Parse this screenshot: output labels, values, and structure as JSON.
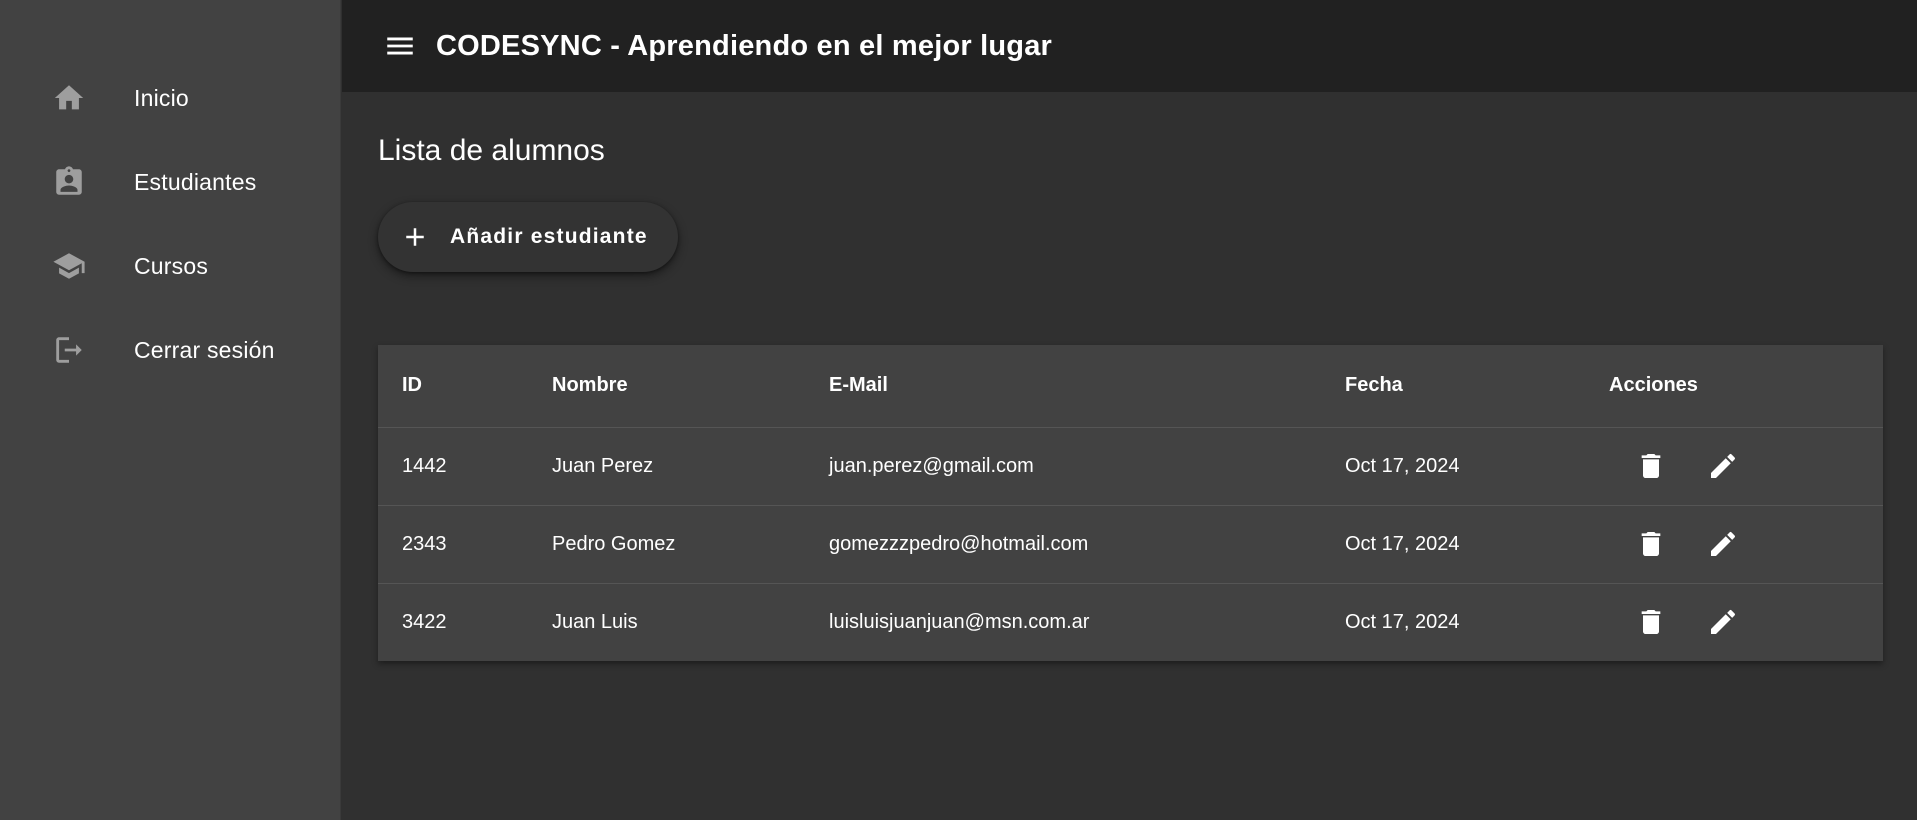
{
  "sidebar": {
    "items": [
      {
        "label": "Inicio",
        "icon": "home-icon"
      },
      {
        "label": "Estudiantes",
        "icon": "assignment-ind-icon"
      },
      {
        "label": "Cursos",
        "icon": "school-icon"
      },
      {
        "label": "Cerrar sesión",
        "icon": "logout-icon"
      }
    ]
  },
  "header": {
    "menu_icon": "menu-icon",
    "title": "CODESYNC - Aprendiendo en el mejor lugar"
  },
  "main": {
    "title": "Lista de alumnos",
    "add_button": {
      "label": "Añadir estudiante",
      "icon": "add-icon"
    },
    "table": {
      "columns": [
        "ID",
        "Nombre",
        "E-Mail",
        "Fecha",
        "Acciones"
      ],
      "rows": [
        {
          "id": "1442",
          "name": "Juan Perez",
          "email": "juan.perez@gmail.com",
          "date": "Oct 17, 2024"
        },
        {
          "id": "2343",
          "name": "Pedro Gomez",
          "email": "gomezzzpedro@hotmail.com",
          "date": "Oct 17, 2024"
        },
        {
          "id": "3422",
          "name": "Juan Luis",
          "email": "luisluisjuanjuan@msn.com.ar",
          "date": "Oct 17, 2024"
        }
      ],
      "row_actions": [
        "delete-icon",
        "edit-icon"
      ]
    }
  },
  "colors": {
    "sidebar_bg": "#424242",
    "topbar_bg": "#212121",
    "main_bg": "#303030",
    "table_bg": "#424242",
    "icon_gray": "#9e9e9e",
    "text": "#ffffff"
  }
}
